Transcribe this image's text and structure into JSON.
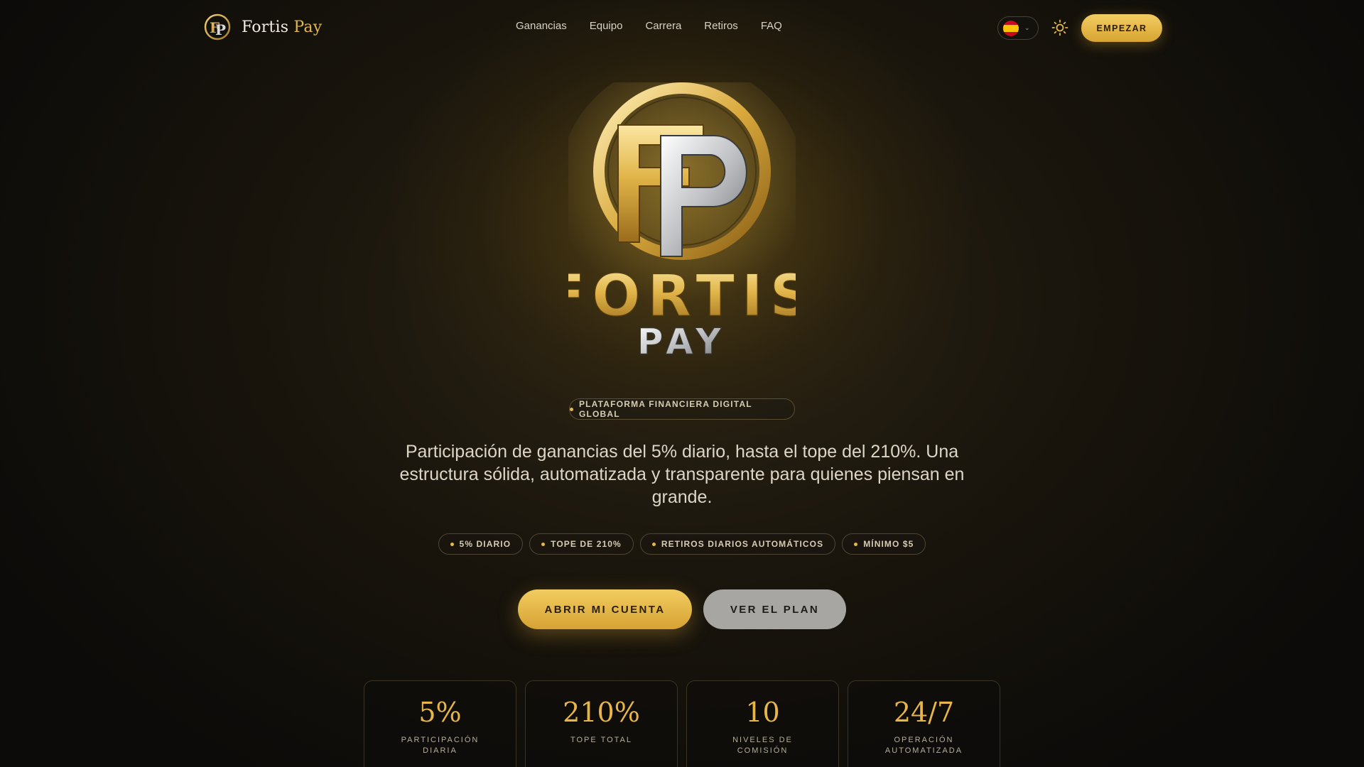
{
  "brand": {
    "name": "Fortis",
    "name_accent": "Pay",
    "logo_icon": "fp-monogram-icon"
  },
  "nav": {
    "links": [
      "Ganancias",
      "Equipo",
      "Carrera",
      "Retiros",
      "FAQ"
    ],
    "language_flag": "spain-flag-icon",
    "theme_icon": "sun-icon",
    "cta": "EMPEZAR"
  },
  "hero": {
    "logo_text_top": "FORTIS",
    "logo_text_bottom": "PAY",
    "tagline": "PLATAFORMA FINANCIERA DIGITAL GLOBAL",
    "lead": "Participación de ganancias del 5% diario, hasta el tope del 210%. Una estructura sólida, automatizada y transparente para quienes piensan en grande.",
    "chips": [
      "5% DIARIO",
      "TOPE DE 210%",
      "RETIROS DIARIOS AUTOMÁTICOS",
      "MÍNIMO $5"
    ],
    "primary_cta": "ABRIR MI CUENTA",
    "secondary_cta": "VER EL PLAN"
  },
  "stats": [
    {
      "value": "5%",
      "label": "PARTICIPACIÓN DIARIA"
    },
    {
      "value": "210%",
      "label": "TOPE TOTAL"
    },
    {
      "value": "10",
      "label": "NIVELES DE COMISIÓN"
    },
    {
      "value": "24/7",
      "label": "OPERACIÓN AUTOMATIZADA"
    }
  ],
  "colors": {
    "accent": "#e2b84a",
    "background": "#18140c",
    "muted_button": "#a8a6a2"
  }
}
